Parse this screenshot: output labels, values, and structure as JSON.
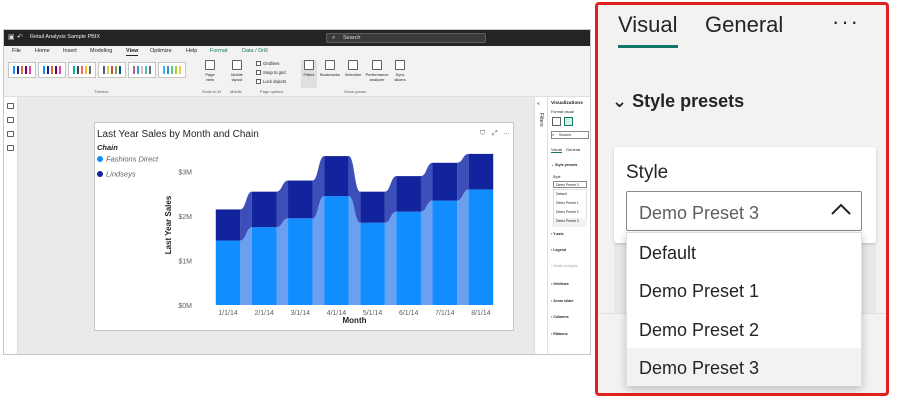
{
  "app": {
    "title": "Retail Analysis Sample PBIX",
    "search_placeholder": "Search",
    "menu": [
      "File",
      "Home",
      "Insert",
      "Modeling",
      "View",
      "Optimize",
      "Help",
      "Format",
      "Data / Drill"
    ],
    "menu_active": "View",
    "ribbon_groups": {
      "themes": "Themes",
      "scale": "Scale to fit",
      "mobile": "Mobile",
      "page_options": "Page options",
      "show_panes": "Show panes"
    },
    "ribbon_buttons": {
      "page_view": "Page view",
      "mobile_layout": "Mobile layout",
      "filters": "Filters",
      "bookmarks": "Bookmarks",
      "selection": "Selection",
      "performance": "Performance analyzer",
      "sync": "Sync slicers"
    },
    "page_options": [
      "Gridlines",
      "Snap to grid",
      "Lock objects"
    ]
  },
  "visualizations_pane": {
    "title": "Visualizations",
    "subtitle": "Format visual",
    "search": "Search",
    "tabs": [
      "Visual",
      "General"
    ],
    "section": "Style presets",
    "style_label": "Style",
    "selected": "Demo Preset 3",
    "options": [
      "Default",
      "Demo Preset 1",
      "Demo Preset 2",
      "Demo Preset 3"
    ],
    "sections": [
      "Y-axis",
      "Legend",
      "Small multiples",
      "Gridlines",
      "Zoom slider",
      "Columns",
      "Ribbons"
    ],
    "filters_label": "Filters"
  },
  "zoom": {
    "tabs": [
      "Visual",
      "General"
    ],
    "more": "···",
    "section": "Style presets",
    "style_label": "Style",
    "selected": "Demo Preset 3",
    "options": [
      "Default",
      "Demo Preset 1",
      "Demo Preset 2",
      "Demo Preset 3"
    ]
  },
  "colors": {
    "fashions": "#118dff",
    "lindseys": "#12239e",
    "ribbon_light": "#6b9ff0",
    "ribbon_dark": "#3c4fb8",
    "accent": "#117865",
    "highlight": "#e0201f"
  },
  "chart_data": {
    "type": "bar",
    "title": "Last Year Sales by Month and Chain",
    "xlabel": "Month",
    "ylabel": "Last Year Sales",
    "legend_title": "Chain",
    "legend_position": "top-left",
    "categories": [
      "1/1/14",
      "2/1/14",
      "3/1/14",
      "4/1/14",
      "5/1/14",
      "6/1/14",
      "7/1/14",
      "8/1/14"
    ],
    "series": [
      {
        "name": "Fashions Direct",
        "values": [
          1.45,
          1.75,
          1.95,
          2.45,
          1.85,
          2.1,
          2.35,
          2.6
        ]
      },
      {
        "name": "Lindseys",
        "values": [
          0.7,
          0.8,
          0.85,
          0.9,
          0.7,
          0.8,
          0.85,
          0.8
        ]
      }
    ],
    "yticks": [
      "$0M",
      "$1M",
      "$2M",
      "$3M"
    ],
    "ylim": [
      0,
      3.6
    ],
    "stacked": true,
    "ribbon": true
  }
}
